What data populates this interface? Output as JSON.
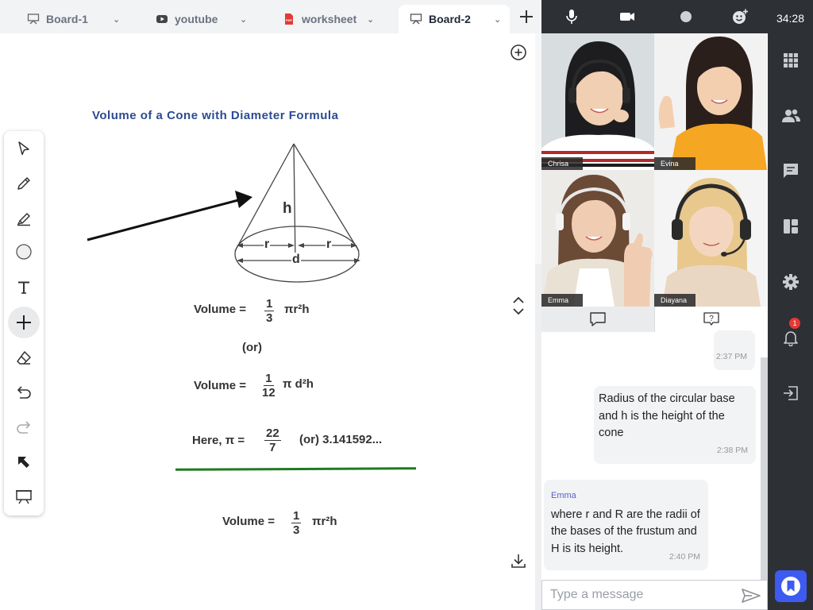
{
  "tabs": [
    {
      "label": "Board-1",
      "icon": "presentation-board-icon"
    },
    {
      "label": "youtube",
      "icon": "youtube-icon"
    },
    {
      "label": "worksheet",
      "icon": "pdf-file-icon"
    },
    {
      "label": "Board-2",
      "icon": "presentation-board-icon",
      "active": true
    }
  ],
  "board": {
    "title": "Volume of a Cone with Diameter Formula",
    "diagram_labels": {
      "h": "h",
      "r1": "r",
      "r2": "r",
      "d": "d"
    },
    "formula1": {
      "prefix": "Volume =",
      "num": "1",
      "den": "3",
      "suffix": "πr²h"
    },
    "or_text": "(or)",
    "formula2": {
      "prefix": "Volume =",
      "num": "1",
      "den": "12",
      "suffix": "π d²h"
    },
    "pi_line": {
      "prefix": "Here,  π  =",
      "num": "22",
      "den": "7",
      "suffix": "(or)  3.141592..."
    },
    "formula3": {
      "prefix": "Volume =",
      "num": "1",
      "den": "3",
      "suffix": "πr²h"
    },
    "annotation_line_color": "#1f7a1f"
  },
  "toolbar_tools": [
    "select-arrow-icon",
    "pencil-icon",
    "highlighter-icon",
    "circle-shape-icon",
    "text-icon",
    "add-icon",
    "eraser-icon",
    "undo-icon",
    "redo-icon",
    "pointer-icon",
    "present-icon"
  ],
  "video": {
    "participants": [
      {
        "name": "Chrisa"
      },
      {
        "name": "Evina"
      },
      {
        "name": "Emma"
      },
      {
        "name": "Diayana"
      }
    ]
  },
  "chat": {
    "messages": [
      {
        "text": "",
        "time": "2:37 PM"
      },
      {
        "text": "Radius of the circular base and h is the height of the cone",
        "time": "2:38 PM"
      },
      {
        "sender": "Emma",
        "text": "where r and R are the radii of the bases of the frustum and H is its height.",
        "time": "2:40 PM"
      }
    ],
    "input_placeholder": "Type a message"
  },
  "rail": {
    "timer": "34:28",
    "notification_count": "1"
  },
  "colors": {
    "accent": "#3d5af1",
    "dark_panel": "#2d3035",
    "title_blue": "#2b4b92"
  }
}
